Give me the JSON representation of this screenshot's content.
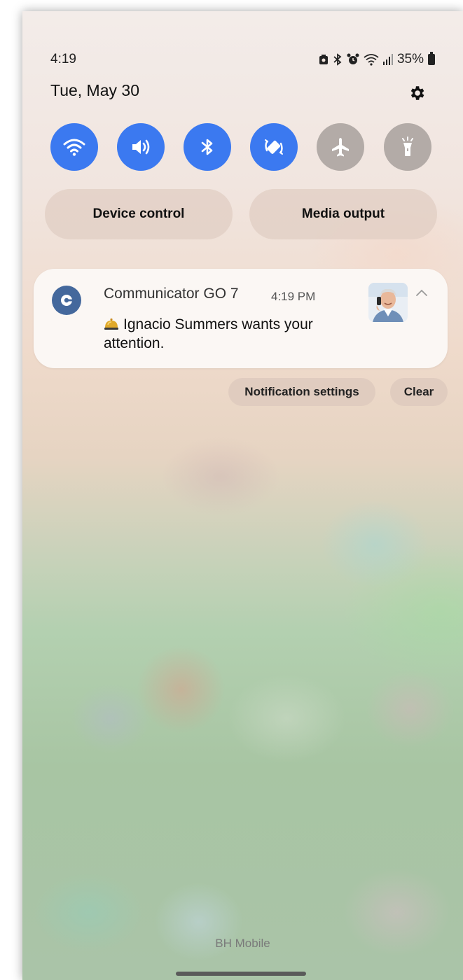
{
  "status_bar": {
    "time": "4:19",
    "battery_percent": "35%",
    "icons": [
      "screenshot-icon",
      "bluetooth-icon",
      "alarm-icon",
      "wifi-icon",
      "signal-icon",
      "battery-icon"
    ]
  },
  "header": {
    "date": "Tue, May 30"
  },
  "quick_settings": {
    "accent_on": "#3b79f0",
    "accent_off": "#b3aba7",
    "tiles": [
      {
        "name": "wifi",
        "state": "on"
      },
      {
        "name": "sound",
        "state": "on"
      },
      {
        "name": "bluetooth",
        "state": "on"
      },
      {
        "name": "auto-rotate",
        "state": "on"
      },
      {
        "name": "airplane-mode",
        "state": "off"
      },
      {
        "name": "flashlight",
        "state": "off"
      }
    ]
  },
  "controls": {
    "device_control": "Device control",
    "media_output": "Media output"
  },
  "notification": {
    "app_name": "Communicator GO 7",
    "time": "4:19 PM",
    "message": "Ignacio Summers wants your attention.",
    "icon_color": "#44689c"
  },
  "notification_actions": {
    "settings": "Notification settings",
    "clear": "Clear"
  },
  "footer": {
    "carrier": "BH Mobile"
  }
}
